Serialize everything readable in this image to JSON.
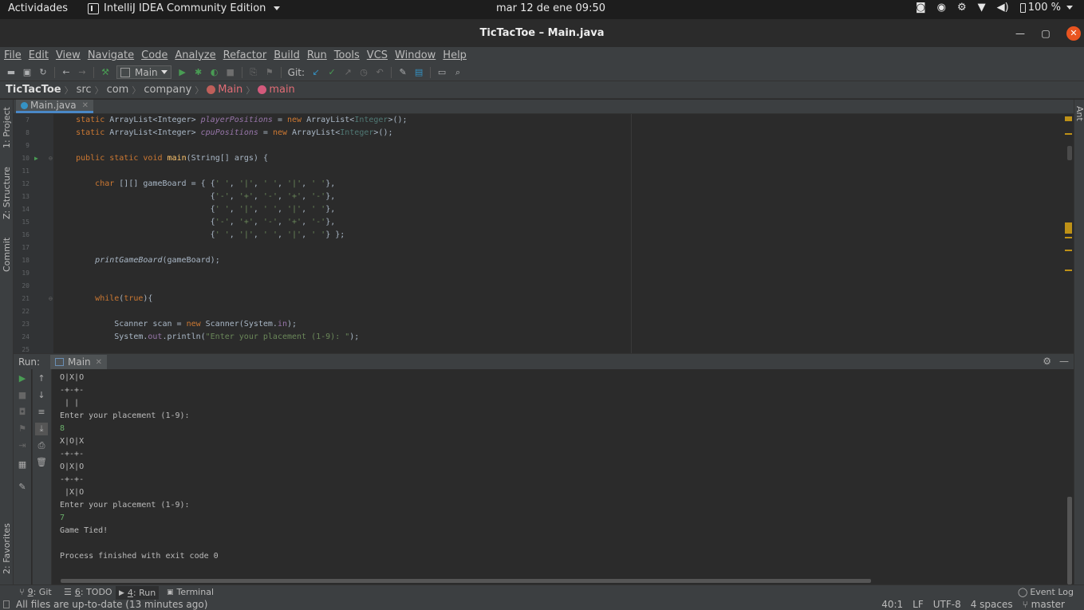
{
  "gnome_bar": {
    "activities": "Actividades",
    "app_name": "IntelliJ IDEA Community Edition",
    "clock": "mar 12 de ene  09:50",
    "battery": "100 %"
  },
  "window": {
    "title": "TicTacToe – Main.java"
  },
  "menubar": [
    "File",
    "Edit",
    "View",
    "Navigate",
    "Code",
    "Analyze",
    "Refactor",
    "Build",
    "Run",
    "Tools",
    "VCS",
    "Window",
    "Help"
  ],
  "toolbar": {
    "run_config": "Main",
    "git_label": "Git:"
  },
  "breadcrumb": [
    "TicTacToe",
    "src",
    "com",
    "company",
    "Main",
    "main"
  ],
  "left_tabs": {
    "project": "1: Project",
    "structure": "Z: Structure",
    "commit": "Commit",
    "favorites": "2: Favorites"
  },
  "right_tabs": {
    "ant": "Ant"
  },
  "editor": {
    "tab": "Main.java",
    "lines": [
      {
        "n": "7",
        "code": "    static ArrayList<Integer> playerPositions = new ArrayList<Integer>();"
      },
      {
        "n": "8",
        "code": "    static ArrayList<Integer> cpuPositions = new ArrayList<Integer>();"
      },
      {
        "n": "9",
        "code": ""
      },
      {
        "n": "10",
        "code": "    public static void main(String[] args) {"
      },
      {
        "n": "11",
        "code": ""
      },
      {
        "n": "12",
        "code": "        char [][] gameBoard = { {' ', '|', ' ', '|', ' '},"
      },
      {
        "n": "13",
        "code": "                                {'-', '+', '-', '+', '-'},"
      },
      {
        "n": "14",
        "code": "                                {' ', '|', ' ', '|', ' '},"
      },
      {
        "n": "15",
        "code": "                                {'-', '+', '-', '+', '-'},"
      },
      {
        "n": "16",
        "code": "                                {' ', '|', ' ', '|', ' '} };"
      },
      {
        "n": "17",
        "code": ""
      },
      {
        "n": "18",
        "code": "        printGameBoard(gameBoard);"
      },
      {
        "n": "19",
        "code": ""
      },
      {
        "n": "20",
        "code": ""
      },
      {
        "n": "21",
        "code": "        while(true){"
      },
      {
        "n": "22",
        "code": ""
      },
      {
        "n": "23",
        "code": "            Scanner scan = new Scanner(System.in);"
      },
      {
        "n": "24",
        "code": "            System.out.println(\"Enter your placement (1-9): \");"
      },
      {
        "n": "25",
        "code": ""
      }
    ]
  },
  "run": {
    "label": "Run:",
    "tab": "Main",
    "output": [
      {
        "t": "O|X|O",
        "in": false
      },
      {
        "t": "-+-+-",
        "in": false
      },
      {
        "t": " | | ",
        "in": false
      },
      {
        "t": "Enter your placement (1-9): ",
        "in": false
      },
      {
        "t": "8",
        "in": true
      },
      {
        "t": "X|O|X",
        "in": false
      },
      {
        "t": "-+-+-",
        "in": false
      },
      {
        "t": "O|X|O",
        "in": false
      },
      {
        "t": "-+-+-",
        "in": false
      },
      {
        "t": " |X|O",
        "in": false
      },
      {
        "t": "Enter your placement (1-9): ",
        "in": false
      },
      {
        "t": "7",
        "in": true
      },
      {
        "t": "Game Tied!",
        "in": false
      },
      {
        "t": "",
        "in": false
      },
      {
        "t": "Process finished with exit code 0",
        "in": false
      }
    ]
  },
  "tool_tabs": {
    "git_num": "9",
    "git": ": Git",
    "todo_num": "6",
    "todo": ": TODO",
    "run_num": "4",
    "run": ": Run",
    "terminal": "Terminal",
    "event_log": "Event Log"
  },
  "status": {
    "message": "All files are up-to-date (13 minutes ago)",
    "position": "40:1",
    "line_sep": "LF",
    "encoding": "UTF-8",
    "indent": "4 spaces",
    "branch": "master"
  },
  "colors": {
    "accent": "#4a88c7",
    "run_green": "#499c54",
    "close_orange": "#e95420"
  }
}
